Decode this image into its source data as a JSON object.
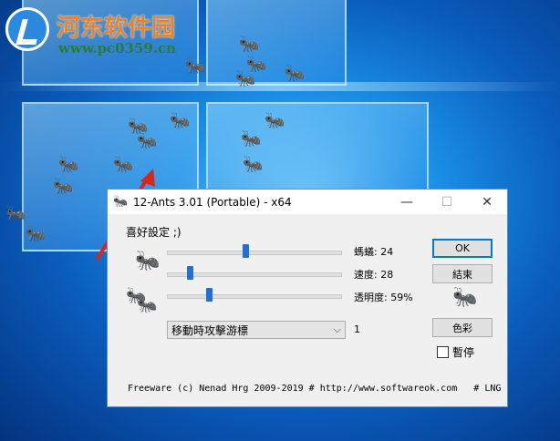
{
  "watermark": {
    "site_name": "河东软件园",
    "url": "www.pc0359.cn"
  },
  "window": {
    "title": "12-Ants 3.01 (Portable) - x64",
    "title_icon": "ant-icon",
    "controls": {
      "minimize": "—",
      "maximize": "☐",
      "close": "✕"
    }
  },
  "settings": {
    "group_label": "喜好設定 ;)",
    "sliders": [
      {
        "label": "螞蟻: 24",
        "value_fraction": 0.45
      },
      {
        "label": "速度: 28",
        "value_fraction": 0.12
      },
      {
        "label": "透明度: 59%",
        "value_fraction": 0.23
      }
    ],
    "dropdown": {
      "selected": "移動時攻擊游標",
      "number": "1"
    }
  },
  "buttons": {
    "ok": "OK",
    "exit": "結束",
    "color": "色彩"
  },
  "pause": {
    "label": "暫停",
    "checked": false
  },
  "footer": {
    "text": "Freeware (c) Nenad Hrg 2009-2019 # http://www.softwareok.com   # LNG"
  }
}
